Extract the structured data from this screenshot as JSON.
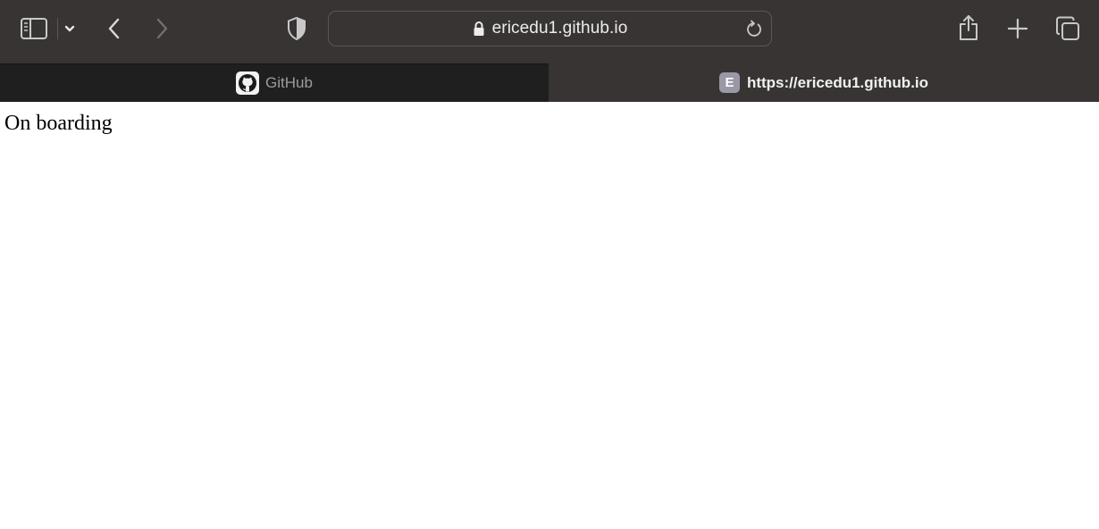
{
  "address_bar": {
    "url": "ericedu1.github.io"
  },
  "tabs": [
    {
      "label": "GitHub",
      "favicon": "github-icon",
      "active": false
    },
    {
      "label": "https://ericedu1.github.io",
      "favicon": "letter-favicon",
      "favicon_letter": "E",
      "active": true
    }
  ],
  "page": {
    "text": "On boarding"
  },
  "icons": {
    "sidebar": "sidebar-icon",
    "chevron": "chevron-down-icon",
    "back": "back-icon",
    "forward": "forward-icon",
    "privacy": "shield-icon",
    "lock": "lock-icon",
    "reload": "reload-icon",
    "share": "share-icon",
    "new_tab": "plus-icon",
    "tab_overview": "tabs-overview-icon"
  },
  "colors": {
    "toolbar": "#383434",
    "inactive_tab": "#1f1f1f",
    "page_background": "#ffffff"
  }
}
